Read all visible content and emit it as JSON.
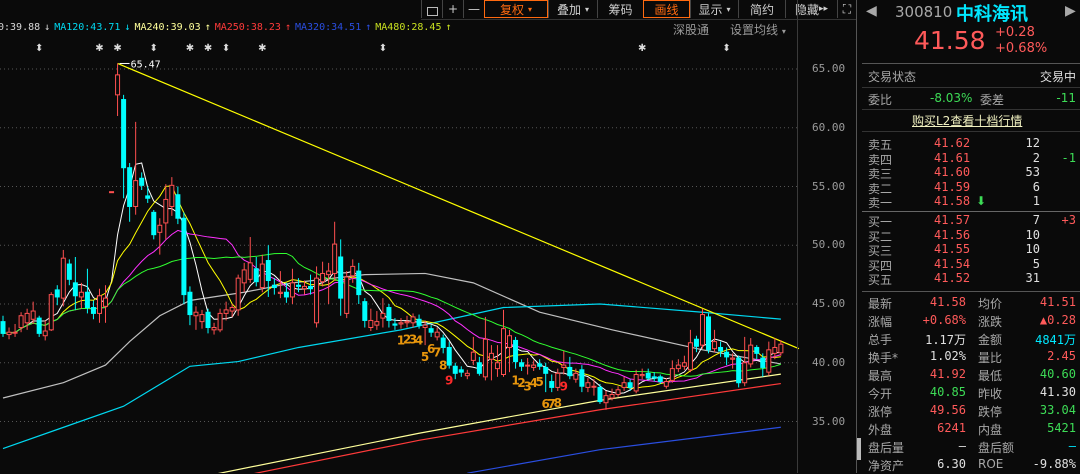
{
  "toolbar": {
    "buttons": [
      {
        "label": "",
        "icon": "lock-icon"
      },
      {
        "label": "+",
        "icon": "zoom-in-icon"
      },
      {
        "label": "—",
        "icon": "zoom-out-icon"
      },
      {
        "label": "复权",
        "dropdown": true,
        "active": true
      },
      {
        "label": "叠加",
        "dropdown": true
      },
      {
        "label": "筹码"
      },
      {
        "label": "画线",
        "active": true
      },
      {
        "label": "显示",
        "dropdown": true
      },
      {
        "label": "简约"
      },
      {
        "label": "隐藏",
        "suffix": "▸▸"
      },
      {
        "label": "⛶",
        "icon": "fullscreen-icon"
      }
    ],
    "sgt": "深股通",
    "set_ma": "设置均线",
    "set_ma_caret": "▾"
  },
  "legend": [
    {
      "text": "0:39.88",
      "arrow": "↓",
      "color": "#d8d8d8"
    },
    {
      "text": "MA120:43.71",
      "arrow": "↓",
      "color": "#00d8f0"
    },
    {
      "text": "MA240:39.03",
      "arrow": "↑",
      "color": "#ffff9a"
    },
    {
      "text": "MA250:38.23",
      "arrow": "↑",
      "color": "#ff3a3a"
    },
    {
      "text": "MA320:34.51",
      "arrow": "↑",
      "color": "#2a4ee0"
    },
    {
      "text": "MA480:28.45",
      "arrow": "↑",
      "color": "#c8e020"
    }
  ],
  "chart_data": {
    "type": "candlestick",
    "ylim": [
      30.6,
      65.4
    ],
    "yticks": [
      "65.00",
      "60.00",
      "55.00",
      "50.00",
      "45.00",
      "40.00",
      "35.00"
    ],
    "ytick_values": [
      65,
      60,
      55,
      50,
      45,
      40,
      35
    ],
    "peak_label": "65.47",
    "candles_ohlc": [
      [
        43.5,
        44,
        42.2,
        42.5
      ],
      [
        42.4,
        43,
        42,
        42.6
      ],
      [
        42.6,
        43.3,
        42.2,
        42.6
      ],
      [
        43,
        44.3,
        42.6,
        44
      ],
      [
        43.4,
        44.6,
        42.8,
        44.2
      ],
      [
        43.7,
        45.2,
        43.3,
        44.4
      ],
      [
        43.8,
        44,
        42.2,
        42.5
      ],
      [
        42.3,
        43.6,
        41.9,
        42.7
      ],
      [
        42.8,
        46,
        42.7,
        45.8
      ],
      [
        46.2,
        46.6,
        44.9,
        45.6
      ],
      [
        45.5,
        49.6,
        44.8,
        48.9
      ],
      [
        48.4,
        48.8,
        46.6,
        47.1
      ],
      [
        46.8,
        49,
        44.5,
        45.7
      ],
      [
        45.6,
        46.8,
        44.6,
        46
      ],
      [
        46,
        48,
        44.2,
        44.7
      ],
      [
        44.7,
        45.3,
        43.7,
        44.2
      ],
      [
        44.2,
        46.3,
        43.4,
        45.7
      ],
      [
        44.8,
        46.6,
        43.4,
        45.5
      ],
      [
        54.56,
        54.56,
        54.56,
        54.56
      ],
      [
        62.8,
        65.47,
        61,
        64.5
      ],
      [
        62.4,
        62.8,
        54,
        56.6
      ],
      [
        56.6,
        57,
        52,
        53.3
      ],
      [
        53.3,
        60.5,
        52.6,
        55.5
      ],
      [
        55.7,
        56.2,
        54.7,
        55.1
      ],
      [
        54.2,
        55,
        53.6,
        54
      ],
      [
        52.8,
        53,
        50.5,
        50.9
      ],
      [
        51.1,
        52.3,
        49.2,
        51.7
      ],
      [
        51.9,
        55.2,
        50.5,
        53.9
      ],
      [
        53.3,
        55.8,
        52.5,
        55.1
      ],
      [
        54.3,
        55,
        51.8,
        52.3
      ],
      [
        52.3,
        52.8,
        45,
        45.8
      ],
      [
        46,
        46.5,
        43.2,
        44.1
      ],
      [
        44,
        44.8,
        42.8,
        44.3
      ],
      [
        43.5,
        44.5,
        42.9,
        44.1
      ],
      [
        44.3,
        44.6,
        42.5,
        43
      ],
      [
        42.8,
        43.4,
        42.4,
        43
      ],
      [
        42.8,
        44.6,
        42.6,
        44.2
      ],
      [
        44.2,
        45.2,
        43.6,
        44.5
      ],
      [
        44.4,
        45,
        43.9,
        44.7
      ],
      [
        44.5,
        47.5,
        44,
        47.2
      ],
      [
        46.8,
        48.5,
        46,
        47.9
      ],
      [
        47.1,
        50.7,
        46.8,
        48.5
      ],
      [
        48,
        49,
        46.5,
        46.9
      ],
      [
        46.4,
        49.2,
        46,
        48.4
      ],
      [
        48.7,
        50,
        45.6,
        47
      ],
      [
        46.6,
        47.2,
        45.8,
        46.4
      ],
      [
        45.9,
        47.8,
        45.5,
        46
      ],
      [
        46,
        46.8,
        45.1,
        45.6
      ],
      [
        45.6,
        48,
        45,
        46.8
      ],
      [
        46.6,
        47.2,
        46,
        46.5
      ],
      [
        46.3,
        47,
        45.8,
        46.5
      ],
      [
        46.5,
        47.5,
        45.8,
        46.3
      ],
      [
        43.4,
        48.2,
        43,
        47.2
      ],
      [
        46.9,
        48.6,
        46.5,
        47.6
      ],
      [
        47.5,
        48.5,
        45,
        47.8
      ],
      [
        47.6,
        52,
        47,
        50.1
      ],
      [
        49,
        50.5,
        44,
        45.5
      ],
      [
        44.2,
        47.8,
        43.8,
        47.3
      ],
      [
        47.4,
        48.8,
        46.8,
        48.2
      ],
      [
        47.8,
        48.5,
        45,
        45.8
      ],
      [
        45.2,
        45.5,
        43,
        43.6
      ],
      [
        43,
        44.6,
        42.7,
        43.6
      ],
      [
        43.2,
        44.4,
        42.8,
        43.5
      ],
      [
        43.8,
        45.5,
        43,
        44.2
      ],
      [
        44.7,
        45,
        43,
        43.6
      ],
      [
        43.3,
        43.8,
        42.8,
        43.2
      ],
      [
        43.3,
        43.8,
        42.9,
        43.4
      ],
      [
        43.4,
        44,
        43,
        43.5
      ],
      [
        43.4,
        44.2,
        43,
        43.9
      ],
      [
        43.7,
        44.1,
        42.9,
        43.2
      ],
      [
        43,
        43.6,
        41.5,
        43.2
      ],
      [
        42.9,
        43.2,
        42.2,
        42.6
      ],
      [
        42.2,
        43,
        41.9,
        42.6
      ],
      [
        42.1,
        42.4,
        40.8,
        41.3
      ],
      [
        41.3,
        41.8,
        39.5,
        39.8
      ],
      [
        39.7,
        40,
        38.6,
        39.1
      ],
      [
        39.4,
        39.7,
        38.8,
        39.2
      ],
      [
        38.9,
        39.4,
        38.6,
        39.1
      ],
      [
        40.2,
        42.2,
        39.8,
        40.9
      ],
      [
        40,
        40.5,
        38.9,
        39.1
      ],
      [
        38.8,
        43.9,
        38.5,
        42
      ],
      [
        40.3,
        41.5,
        38.5,
        40.8
      ],
      [
        39.5,
        41.5,
        38.8,
        40
      ],
      [
        39,
        44.5,
        38.8,
        42.9
      ],
      [
        41.3,
        42.8,
        39.2,
        42.3
      ],
      [
        41.9,
        42.2,
        39.5,
        40.1
      ],
      [
        40,
        40.3,
        39.3,
        39.7
      ],
      [
        39.8,
        40.4,
        39,
        39.8
      ],
      [
        39.6,
        40.2,
        39.3,
        39.8
      ],
      [
        39.9,
        40.3,
        39.4,
        39.7
      ],
      [
        39.6,
        40,
        37.5,
        39.1
      ],
      [
        38.4,
        39,
        37.5,
        37.9
      ],
      [
        37.9,
        39.5,
        37.6,
        39.1
      ],
      [
        39.6,
        41,
        39,
        39.8
      ],
      [
        39.6,
        40.5,
        38.6,
        38.9
      ],
      [
        38.6,
        39.5,
        38.3,
        39.1
      ],
      [
        39.4,
        39.8,
        37.5,
        38
      ],
      [
        37.9,
        38.7,
        37.5,
        38.3
      ],
      [
        38,
        38.6,
        37.2,
        38
      ],
      [
        37.9,
        38.2,
        36.5,
        36.7
      ],
      [
        36.6,
        37.6,
        36,
        37.2
      ],
      [
        37,
        37.8,
        36.8,
        37.3
      ],
      [
        37.3,
        38,
        37.1,
        37.7
      ],
      [
        37.9,
        38.8,
        37.6,
        38.3
      ],
      [
        38.3,
        38.6,
        37.6,
        37.9
      ],
      [
        37.6,
        39.4,
        37.4,
        39
      ],
      [
        38.9,
        39.5,
        38.6,
        39
      ],
      [
        39.1,
        39.5,
        38.5,
        38.7
      ],
      [
        38.8,
        39.2,
        38.4,
        38.7
      ],
      [
        38.8,
        39,
        38.2,
        38.4
      ],
      [
        38,
        38.7,
        37.8,
        38.4
      ],
      [
        38.5,
        40.2,
        38.3,
        39.5
      ],
      [
        39.5,
        40.3,
        39.2,
        39.8
      ],
      [
        39.7,
        40.6,
        39.4,
        40
      ],
      [
        39.4,
        42.8,
        39.2,
        41.7
      ],
      [
        42,
        42.3,
        40.9,
        41.4
      ],
      [
        41.5,
        44.6,
        41.2,
        44.1
      ],
      [
        43.9,
        44.2,
        40.8,
        41.1
      ],
      [
        41.2,
        42.8,
        40.9,
        41.8
      ],
      [
        41.3,
        41.8,
        40.5,
        41
      ],
      [
        40.9,
        41.3,
        39.8,
        40.5
      ],
      [
        40.3,
        40.8,
        39.5,
        40.4
      ],
      [
        40.4,
        40.6,
        37.9,
        38.3
      ],
      [
        38.3,
        42.2,
        38,
        40
      ],
      [
        39.9,
        42.1,
        39.6,
        41.5
      ],
      [
        41.3,
        41.5,
        40.3,
        40.8
      ],
      [
        40.4,
        40.8,
        38.8,
        39.6
      ],
      [
        39.2,
        41.8,
        38.9,
        41.1
      ],
      [
        40.8,
        42.1,
        40.3,
        41.3
      ],
      [
        40.85,
        41.92,
        40.6,
        41.58
      ]
    ],
    "computed_ma": [
      {
        "period": 5,
        "color": "#ffffff"
      },
      {
        "period": 10,
        "color": "#ffff00"
      },
      {
        "period": 20,
        "color": "#ff30ff"
      },
      {
        "period": 30,
        "color": "#30ff30"
      }
    ],
    "long_ma": [
      {
        "name": "MA60",
        "color": "#c0c0c0",
        "points": [
          [
            0,
            37
          ],
          [
            10,
            38.3
          ],
          [
            17,
            39.8
          ],
          [
            21,
            41.8
          ],
          [
            26,
            44
          ],
          [
            31,
            45.3
          ],
          [
            40,
            46
          ],
          [
            48,
            46.8
          ],
          [
            60,
            47.5
          ],
          [
            70,
            47.6
          ],
          [
            78,
            46.8
          ],
          [
            89,
            44.3
          ],
          [
            101,
            42.8
          ],
          [
            116,
            41.1
          ],
          [
            129,
            39.9
          ]
        ]
      },
      {
        "name": "MA120",
        "color": "#00d8f0",
        "points": [
          [
            0,
            32.7
          ],
          [
            10,
            34.5
          ],
          [
            20,
            36.3
          ],
          [
            31,
            39.7
          ],
          [
            39,
            40.1
          ],
          [
            49,
            41.3
          ],
          [
            66,
            42.8
          ],
          [
            83,
            44.7
          ],
          [
            99,
            45
          ],
          [
            116,
            44.3
          ],
          [
            129,
            43.71
          ]
        ]
      },
      {
        "name": "MA240",
        "color": "#ffff9a",
        "points": [
          [
            35,
            30.5
          ],
          [
            69,
            34
          ],
          [
            99,
            36.8
          ],
          [
            129,
            39.03
          ]
        ]
      },
      {
        "name": "MA250",
        "color": "#ff3a3a",
        "points": [
          [
            41,
            30.5
          ],
          [
            69,
            33.4
          ],
          [
            99,
            36
          ],
          [
            129,
            38.23
          ]
        ]
      },
      {
        "name": "MA320",
        "color": "#2a4ee0",
        "points": [
          [
            77,
            30.6
          ],
          [
            99,
            32.6
          ],
          [
            129,
            34.51
          ]
        ]
      }
    ],
    "trendline": {
      "color": "#ffff00",
      "from": [
        19,
        65.47
      ],
      "to": [
        132,
        41.2
      ]
    },
    "top_markers": [
      {
        "candle": 6,
        "glyph": "⬍"
      },
      {
        "candle": 16,
        "glyph": "✱"
      },
      {
        "candle": 19,
        "glyph": "✱"
      },
      {
        "candle": 25,
        "glyph": "⬍"
      },
      {
        "candle": 31,
        "glyph": "✱"
      },
      {
        "candle": 34,
        "glyph": "✱"
      },
      {
        "candle": 37,
        "glyph": "⬍"
      },
      {
        "candle": 43,
        "glyph": "✱"
      },
      {
        "candle": 63,
        "glyph": "⬍"
      },
      {
        "candle": 106,
        "glyph": "✱"
      },
      {
        "candle": 120,
        "glyph": "⬍"
      }
    ],
    "td_labels": [
      {
        "candle": 66,
        "digit": "1"
      },
      {
        "candle": 67,
        "digit": "2"
      },
      {
        "candle": 68,
        "digit": "3"
      },
      {
        "candle": 69,
        "digit": "4"
      },
      {
        "candle": 70,
        "digit": "5"
      },
      {
        "candle": 71,
        "digit": "6"
      },
      {
        "candle": 72,
        "digit": "7"
      },
      {
        "candle": 73,
        "digit": "8"
      },
      {
        "candle": 74,
        "digit": "9",
        "final": true
      },
      {
        "candle": 85,
        "digit": "1"
      },
      {
        "candle": 86,
        "digit": "2"
      },
      {
        "candle": 87,
        "digit": "3"
      },
      {
        "candle": 88,
        "digit": "4"
      },
      {
        "candle": 89,
        "digit": "5"
      },
      {
        "candle": 90,
        "digit": "6"
      },
      {
        "candle": 91,
        "digit": "7"
      },
      {
        "candle": 92,
        "digit": "8"
      },
      {
        "candle": 93,
        "digit": "9",
        "final": true
      }
    ]
  },
  "quote": {
    "prev": "◀",
    "next": "▶",
    "code": "300810",
    "name": "中科海讯",
    "price": "41.58",
    "change": "+0.28",
    "change_pct": "+0.68%",
    "status_label": "交易状态",
    "status_value": "交易中",
    "wb_label": "委比",
    "wb_value": "-8.03%",
    "wc_label": "委差",
    "wc_value": "-11",
    "l2_link": "购买L2查看十档行情"
  },
  "order_book": {
    "sell": [
      {
        "name": "卖五",
        "price": "41.62",
        "vol": "12",
        "chg": ""
      },
      {
        "name": "卖四",
        "price": "41.61",
        "vol": "2",
        "chg": "-1"
      },
      {
        "name": "卖三",
        "price": "41.60",
        "vol": "53",
        "chg": ""
      },
      {
        "name": "卖二",
        "price": "41.59",
        "vol": "6",
        "chg": ""
      },
      {
        "name": "卖一",
        "price": "41.58",
        "vol": "1",
        "chg": "",
        "arrow": "⬇"
      }
    ],
    "buy": [
      {
        "name": "买一",
        "price": "41.57",
        "vol": "7",
        "chg": "+3"
      },
      {
        "name": "买二",
        "price": "41.56",
        "vol": "10",
        "chg": ""
      },
      {
        "name": "买三",
        "price": "41.55",
        "vol": "10",
        "chg": ""
      },
      {
        "name": "买四",
        "price": "41.54",
        "vol": "5",
        "chg": ""
      },
      {
        "name": "买五",
        "price": "41.52",
        "vol": "31",
        "chg": ""
      }
    ]
  },
  "stats": [
    {
      "l1": "最新",
      "v1": "41.58",
      "c1": "red",
      "l2": "均价",
      "v2": "41.51",
      "c2": "red"
    },
    {
      "l1": "涨幅",
      "v1": "+0.68%",
      "c1": "red",
      "l2": "涨跌",
      "v2": "▲0.28",
      "c2": "red"
    },
    {
      "l1": "总手",
      "v1": "1.17万",
      "c1": "white",
      "l2": "金额",
      "v2": "4841万",
      "c2": "cyan"
    },
    {
      "l1": "换手*",
      "v1": "1.02%",
      "c1": "white",
      "l2": "量比",
      "v2": "2.45",
      "c2": "red"
    },
    {
      "l1": "最高",
      "v1": "41.92",
      "c1": "red",
      "l2": "最低",
      "v2": "40.60",
      "c2": "green"
    },
    {
      "l1": "今开",
      "v1": "40.85",
      "c1": "green",
      "l2": "昨收",
      "v2": "41.30",
      "c2": "white"
    },
    {
      "l1": "涨停",
      "v1": "49.56",
      "c1": "red",
      "l2": "跌停",
      "v2": "33.04",
      "c2": "green"
    },
    {
      "l1": "外盘",
      "v1": "6241",
      "c1": "red",
      "l2": "内盘",
      "v2": "5421",
      "c2": "green"
    },
    {
      "l1": "盘后量",
      "v1": "—",
      "c1": "white",
      "l2": "盘后额",
      "v2": "—",
      "c2": "cyan"
    },
    {
      "l1": "净资产",
      "v1": "6.30",
      "c1": "white",
      "l2": "ROE",
      "v2": "-9.88%",
      "c2": "white"
    }
  ]
}
